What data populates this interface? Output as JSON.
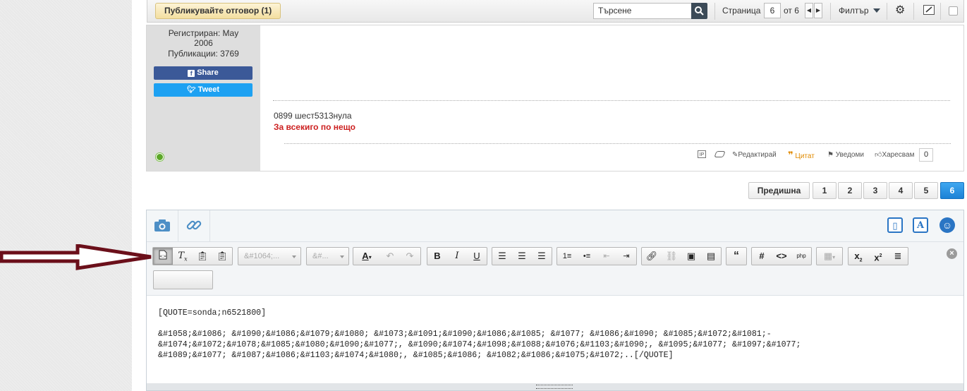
{
  "topbar": {
    "post_reply_label": "Публикувайте отговор (1)",
    "search_placeholder": "Търсене",
    "page_label": "Страница",
    "page_current": "6",
    "page_of": "от 6",
    "filter_label": "Филтър"
  },
  "post": {
    "registered": "Регистриран: May 2006",
    "registered_line1": "Регистриран: May",
    "registered_line2": "2006",
    "posts": "Публикации: 3769",
    "share_label": "Share",
    "tweet_label": "Tweet",
    "signature_phone": "0899 шест5313нула",
    "signature_tagline": "За всекиго по нещо",
    "actions": {
      "ip": "IP",
      "edit": "Редактирай",
      "quote": "Цитат",
      "notify": "Уведоми",
      "like": "Харесвам",
      "like_count": "0"
    }
  },
  "pagination": {
    "prev": "Предишна",
    "pages": [
      "1",
      "2",
      "3",
      "4",
      "5",
      "6"
    ],
    "active": "6"
  },
  "editor": {
    "font_select": "&#1064;...",
    "size_select": "&#...",
    "content": {
      "quote_open": "[QUOTE=sonda;n6521800]",
      "line1": "&#1058;&#1086; &#1090;&#1086;&#1079;&#1080; &#1073;&#1091;&#1090;&#1086;&#1085; &#1077; &#1086;&#1090; &#1085;&#1072;&#1081;-",
      "line2": "&#1074;&#1072;&#1078;&#1085;&#1080;&#1090;&#1077;, &#1090;&#1074;&#1098;&#1088;&#1076;&#1103;&#1090;, &#1095;&#1077; &#1097;&#1077;",
      "line3": "&#1089;&#1077; &#1087;&#1086;&#1103;&#1074;&#1080;, &#1085;&#1086; &#1082;&#1086;&#1075;&#1072;..[/QUOTE]"
    }
  },
  "colors": {
    "accent": "#2a75c4",
    "facebook": "#3b5998",
    "twitter": "#1da1f2",
    "signature_red": "#cc1f1f",
    "online": "#5ca728",
    "arrow": "#6b0f1a"
  }
}
